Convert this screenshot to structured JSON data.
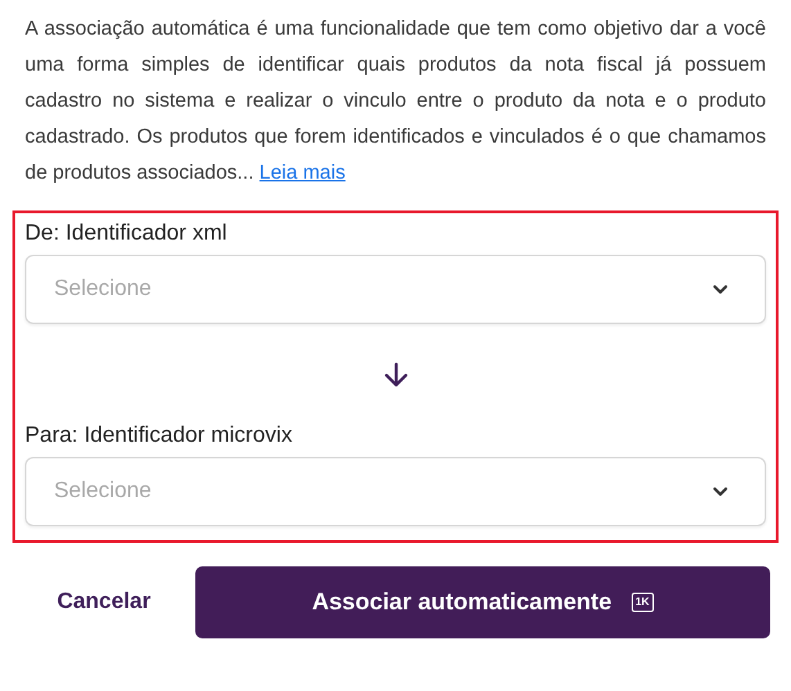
{
  "description": {
    "text": "A associação automática é uma funcionalidade que tem como objetivo dar a você uma forma simples de identificar quais produtos da nota fiscal já possuem cadastro no sistema e realizar o vinculo entre o produto da nota e o produto cadastrado. Os produtos que forem identificados e vinculados é o que chamamos de produtos associados...",
    "link": "Leia mais"
  },
  "fields": [
    {
      "label": "De: Identificador xml",
      "placeholder": "Selecione"
    },
    {
      "label": "Para: Identificador microvix",
      "placeholder": "Selecione"
    }
  ],
  "buttons": [
    {
      "kind": "text",
      "label": "Cancelar"
    },
    {
      "kind": "primary",
      "label": "Associar automaticamente",
      "shortcut": "1K"
    }
  ]
}
